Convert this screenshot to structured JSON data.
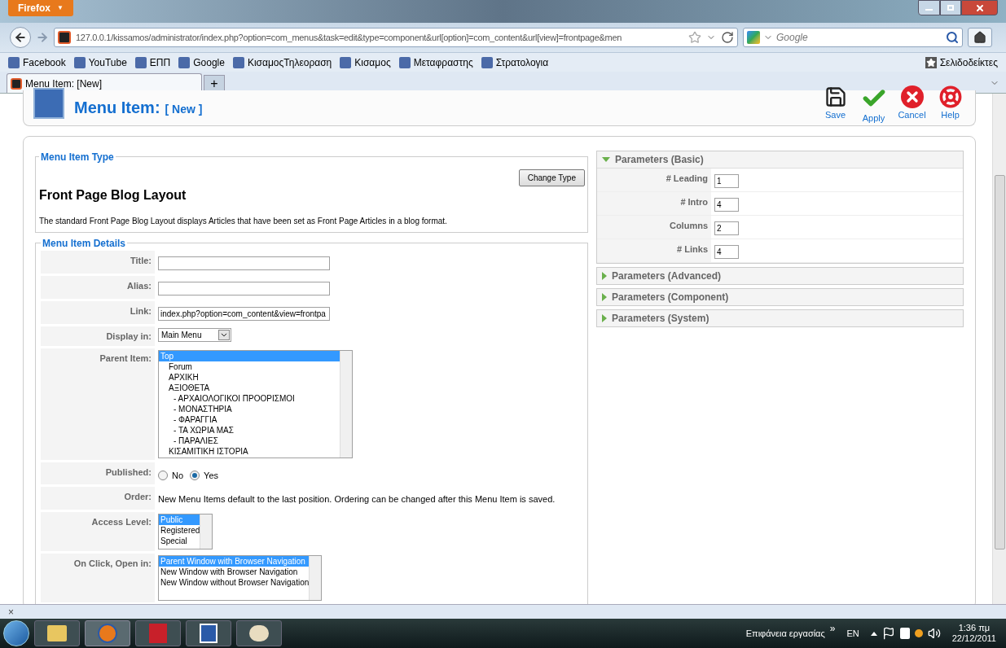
{
  "browser": {
    "menu_button": "Firefox",
    "menu_arrow": "▼",
    "address": "127.0.0.1/kissamos/administrator/index.php?option=com_menus&task=edit&type=component&url[option]=com_content&url[view]=frontpage&men",
    "search_placeholder": "Google"
  },
  "bookmarks": [
    "Facebook",
    "YouTube",
    "ΕΠΠ",
    "Google",
    "ΚισαμοςΤηλεοραση",
    "Κισαμος",
    "Μεταφραστης",
    "Στρατολογια"
  ],
  "bookmarks_menu": "Σελιδοδείκτες",
  "tabs": [
    {
      "label": "Menu Item: [New]",
      "selected": true
    }
  ],
  "new_tab": "+",
  "page_header": {
    "title": "Menu Item:",
    "subtitle": "[ New ]"
  },
  "toolbar": [
    {
      "kind": "save",
      "label": "Save"
    },
    {
      "kind": "apply",
      "label": "Apply"
    },
    {
      "kind": "cancel",
      "label": "Cancel"
    },
    {
      "kind": "help",
      "label": "Help"
    }
  ],
  "menu_item_type": {
    "legend": "Menu Item Type",
    "button": "Change Type",
    "heading": "Front Page Blog Layout",
    "description": "The standard Front Page Blog Layout displays Articles that have been set as Front Page Articles in a blog format."
  },
  "menu_item_details": {
    "legend": "Menu Item Details",
    "rows": [
      {
        "kind": "text",
        "label": "Title:",
        "value": ""
      },
      {
        "kind": "text",
        "label": "Alias:",
        "value": ""
      },
      {
        "kind": "text",
        "label": "Link:",
        "value": "index.php?option=com_content&view=frontpa"
      },
      {
        "kind": "select",
        "label": "Display in:",
        "value": "Main Menu"
      },
      {
        "kind": "listbox",
        "label": "Parent Item:",
        "options": [
          {
            "label": "Top",
            "selected": true,
            "children": [
              {
                "label": "Forum",
                "selected": false
              },
              {
                "label": "ΑΡΧΙΚΗ",
                "selected": false
              },
              {
                "label": "ΑΞΙΟΘΕΤΑ",
                "selected": false,
                "children": [
                  {
                    "label": "- ΑΡΧΑΙΟΛΟΓΙΚΟΙ ΠΡΟΟΡΙΣΜΟΙ",
                    "selected": false
                  },
                  {
                    "label": "- ΜΟΝΑΣΤΗΡΙΑ",
                    "selected": false
                  },
                  {
                    "label": "- ΦΑΡΑΓΓΙΑ",
                    "selected": false
                  },
                  {
                    "label": "- ΤΑ ΧΩΡΙΑ ΜΑΣ",
                    "selected": false
                  },
                  {
                    "label": "- ΠΑΡΑΛΙΕΣ",
                    "selected": false
                  }
                ]
              },
              {
                "label": "ΚΙΣΑΜΙΤΙΚΗ ΙΣΤΟΡΙΑ",
                "selected": false
              }
            ]
          }
        ]
      },
      {
        "kind": "radio",
        "label": "Published:",
        "options": [
          {
            "label": "No",
            "selected": false
          },
          {
            "label": "Yes",
            "selected": true
          }
        ]
      },
      {
        "kind": "note",
        "label": "Order:",
        "value": "New Menu Items default to the last position. Ordering can be changed after this Menu Item is saved."
      },
      {
        "kind": "listbox",
        "label": "Access Level:",
        "options": [
          {
            "label": "Public",
            "selected": true
          },
          {
            "label": "Registered",
            "selected": false
          },
          {
            "label": "Special",
            "selected": false
          }
        ]
      },
      {
        "kind": "listbox",
        "label": "On Click, Open in:",
        "options": [
          {
            "label": "Parent Window with Browser Navigation",
            "selected": true
          },
          {
            "label": "New Window with Browser Navigation",
            "selected": false
          },
          {
            "label": "New Window without Browser Navigation",
            "selected": false
          }
        ]
      }
    ]
  },
  "parameters": [
    {
      "title": "Parameters (Basic)",
      "expanded": true,
      "fields": [
        {
          "label": "# Leading",
          "value": "1"
        },
        {
          "label": "# Intro",
          "value": "4"
        },
        {
          "label": "Columns",
          "value": "2"
        },
        {
          "label": "# Links",
          "value": "4"
        }
      ]
    },
    {
      "title": "Parameters (Advanced)",
      "expanded": false
    },
    {
      "title": "Parameters (Component)",
      "expanded": false
    },
    {
      "title": "Parameters (System)",
      "expanded": false
    }
  ],
  "find_bar": {
    "close": "×"
  },
  "taskbar": {
    "desktop": "Επιφάνεια εργασίας",
    "chevron": "»",
    "language": "EN",
    "time": "1:36 πμ",
    "date": "22/12/2011"
  }
}
